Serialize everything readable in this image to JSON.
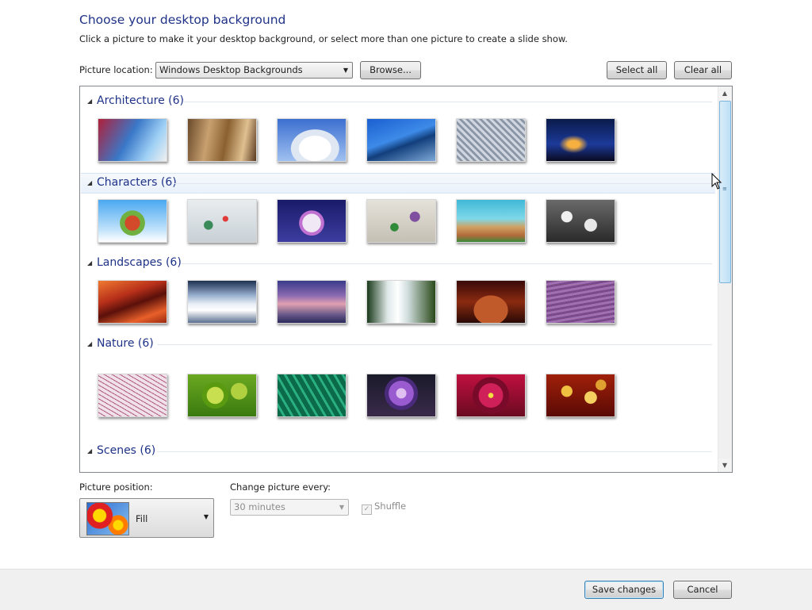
{
  "header": {
    "title": "Choose your desktop background",
    "subtitle": "Click a picture to make it your desktop background, or select more than one picture to create a slide show."
  },
  "location": {
    "label": "Picture location:",
    "value": "Windows Desktop Backgrounds",
    "browse_label": "Browse...",
    "select_all_label": "Select all",
    "clear_all_label": "Clear all"
  },
  "groups": [
    {
      "name": "Architecture (6)"
    },
    {
      "name": "Characters (6)"
    },
    {
      "name": "Landscapes (6)"
    },
    {
      "name": "Nature (6)"
    },
    {
      "name": "Scenes (6)"
    }
  ],
  "position": {
    "label": "Picture position:",
    "value": "Fill"
  },
  "change": {
    "label": "Change picture every:",
    "value": "30 minutes",
    "shuffle_label": "Shuffle"
  },
  "footer": {
    "save_label": "Save changes",
    "cancel_label": "Cancel"
  },
  "icons": [
    "collapse-triangle-icon",
    "dropdown-arrow-icon",
    "scroll-up-icon",
    "scroll-down-icon",
    "checkmark-icon",
    "mouse-pointer-icon"
  ],
  "colors": {
    "title": "#1e3287",
    "accent": "#3c7fb1"
  }
}
